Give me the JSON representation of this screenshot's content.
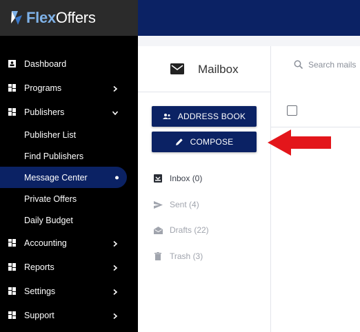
{
  "brand": {
    "part1": "Flex",
    "part2": "Offers"
  },
  "nav": {
    "dashboard": "Dashboard",
    "programs": "Programs",
    "publishers": "Publishers",
    "publisher_list": "Publisher List",
    "find_publishers": "Find Publishers",
    "message_center": "Message Center",
    "private_offers": "Private Offers",
    "daily_budget": "Daily Budget",
    "accounting": "Accounting",
    "reports": "Reports",
    "settings": "Settings",
    "support": "Support"
  },
  "mailbox": {
    "title": "Mailbox",
    "search_placeholder": "Search mails",
    "address_book": "ADDRESS BOOK",
    "compose": "COMPOSE",
    "folders": {
      "inbox": "Inbox (0)",
      "sent": "Sent (4)",
      "drafts": "Drafts (22)",
      "trash": "Trash (3)"
    }
  },
  "colors": {
    "navy": "#0b2264",
    "sidebar_bg": "#000000",
    "arrow": "#e3161b"
  }
}
